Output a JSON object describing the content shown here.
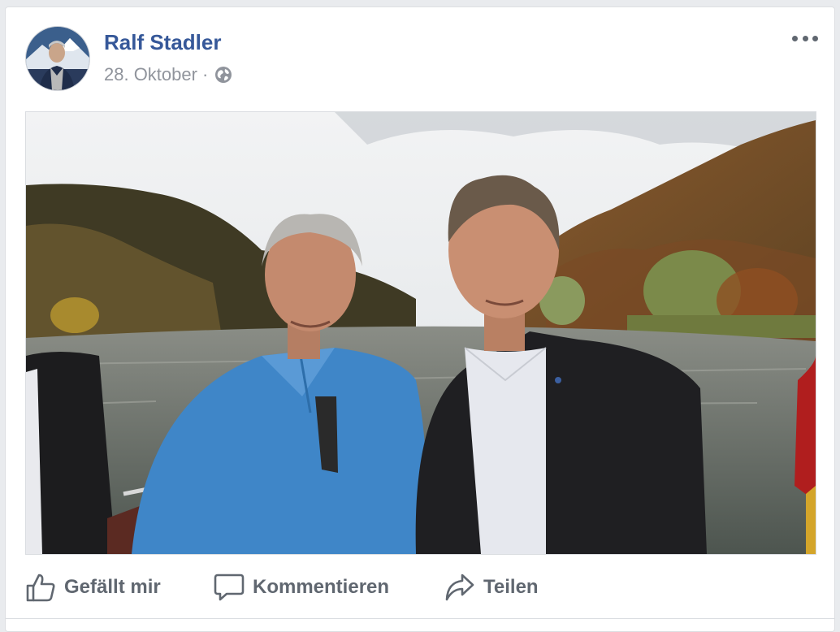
{
  "post": {
    "author_name": "Ralf Stadler",
    "date": "28. Oktober",
    "separator": "·",
    "privacy_icon": "globe-icon",
    "menu_icon": "more-options-icon"
  },
  "actions": {
    "like_label": "Gefällt mir",
    "like_icon": "thumbs-up-icon",
    "comment_label": "Kommentieren",
    "comment_icon": "speech-bubble-icon",
    "share_label": "Teilen",
    "share_icon": "share-arrow-icon"
  },
  "colors": {
    "author_link": "#365899",
    "meta_text": "#90949c",
    "action_text": "#606770",
    "page_background": "#e9ebee"
  }
}
